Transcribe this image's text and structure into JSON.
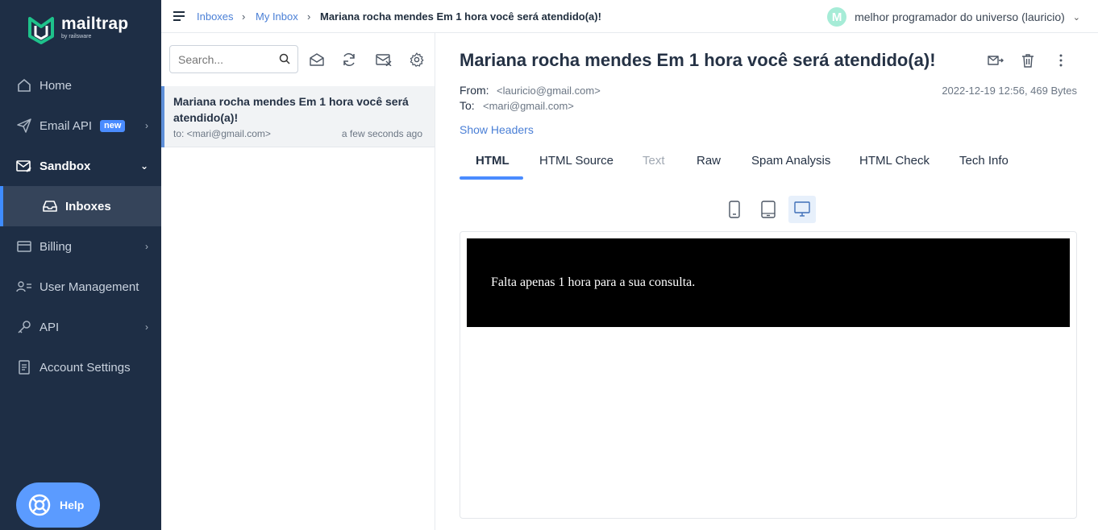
{
  "brand": {
    "name": "mailtrap",
    "tagline": "by railsware",
    "accent": "#3f8cff",
    "sidebar_bg": "#1e2e45",
    "logo_green": "#1ec28b"
  },
  "sidebar": {
    "items": [
      {
        "label": "Home",
        "icon": "home-icon"
      },
      {
        "label": "Email API",
        "icon": "send-icon",
        "badge": "new"
      },
      {
        "label": "Sandbox",
        "icon": "sandbox-icon"
      },
      {
        "label": "Inboxes",
        "icon": "inbox-icon"
      },
      {
        "label": "Billing",
        "icon": "card-icon"
      },
      {
        "label": "User Management",
        "icon": "users-icon"
      },
      {
        "label": "API",
        "icon": "key-icon"
      },
      {
        "label": "Account Settings",
        "icon": "document-icon"
      }
    ],
    "help_label": "Help"
  },
  "topbar": {
    "breadcrumb": [
      "Inboxes",
      "My Inbox",
      "Mariana rocha mendes Em 1 hora você será atendido(a)!"
    ],
    "avatar_letter": "M",
    "user_name": "melhor programador do universo (lauricio)"
  },
  "list": {
    "search_placeholder": "Search...",
    "messages": [
      {
        "subject": "Mariana rocha mendes Em 1 hora você será atendido(a)!",
        "to": "to: <mari@gmail.com>",
        "time": "a few seconds ago"
      }
    ]
  },
  "message": {
    "subject": "Mariana rocha mendes Em 1 hora você será atendido(a)!",
    "from_label": "From:",
    "from": "<lauricio@gmail.com>",
    "to_label": "To:",
    "to": "<mari@gmail.com>",
    "meta": "2022-12-19 12:56, 469 Bytes",
    "show_headers": "Show Headers",
    "tabs": [
      {
        "label": "HTML",
        "state": "selected"
      },
      {
        "label": "HTML Source",
        "state": "normal"
      },
      {
        "label": "Text",
        "state": "disabled"
      },
      {
        "label": "Raw",
        "state": "normal"
      },
      {
        "label": "Spam Analysis",
        "state": "normal"
      },
      {
        "label": "HTML Check",
        "state": "normal"
      },
      {
        "label": "Tech Info",
        "state": "normal"
      }
    ],
    "preview_device": "desktop",
    "body_text": "Falta apenas 1 hora para a sua consulta."
  }
}
